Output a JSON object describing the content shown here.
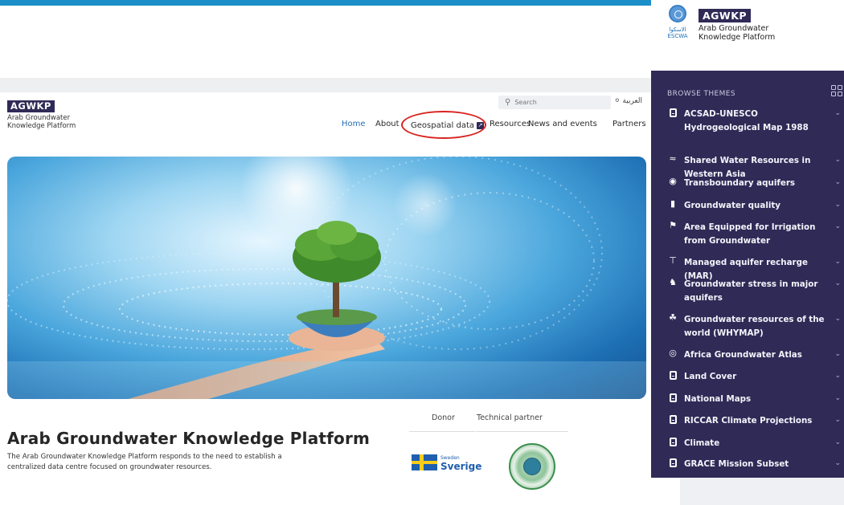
{
  "site": {
    "logo_title": "AGWKP",
    "logo_sub_line1": "Arab Groundwater",
    "logo_sub_line2": "Knowledge Platform",
    "search_placeholder": "Search",
    "language": "العربية"
  },
  "nav": {
    "home": "Home",
    "about": "About",
    "geospatial": "Geospatial data",
    "resources": "Resources",
    "news": "News and events",
    "partners": "Partners"
  },
  "main": {
    "title": "Arab Groundwater Knowledge Platform",
    "description": "The Arab Groundwater Knowledge Platform responds to the need to establish a centralized data centre focused on groundwater resources.",
    "donor_label": "Donor",
    "technical_partner_label": "Technical partner",
    "sweden_small": "Sweden",
    "sweden_big": "Sverige"
  },
  "panel": {
    "escwa_label_ar": "الاسكوا",
    "escwa_label": "ESCWA",
    "logo_title": "AGWKP",
    "logo_sub_line1": "Arab Groundwater",
    "logo_sub_line2": "Knowledge Platform",
    "browse_label": "BROWSE THEMES",
    "themes": [
      {
        "label": "ACSAD-UNESCO Hydrogeological Map 1988",
        "icon": "map-icon"
      },
      {
        "label": "Shared Water Resources in Western Asia",
        "icon": "waves-icon"
      },
      {
        "label": "Transboundary aquifers",
        "icon": "globe-icon"
      },
      {
        "label": "Groundwater quality",
        "icon": "water-glass-icon"
      },
      {
        "label": "Area Equipped for Irrigation from Groundwater",
        "icon": "irrigation-icon"
      },
      {
        "label": "Managed aquifer recharge (MAR)",
        "icon": "recharge-icon"
      },
      {
        "label": "Groundwater stress in major aquifers",
        "icon": "tap-icon"
      },
      {
        "label": "Groundwater resources of the world (WHYMAP)",
        "icon": "world-resources-icon"
      },
      {
        "label": "Africa Groundwater Atlas",
        "icon": "atlas-globe-icon"
      },
      {
        "label": "Land Cover",
        "icon": "map-icon"
      },
      {
        "label": "National Maps",
        "icon": "map-icon"
      },
      {
        "label": "RICCAR Climate Projections",
        "icon": "map-icon"
      },
      {
        "label": "Climate",
        "icon": "map-icon"
      },
      {
        "label": "GRACE Mission Subset",
        "icon": "map-icon"
      }
    ]
  },
  "colors": {
    "panel_bg": "#2f2a56",
    "top_bar": "#1d8fc8",
    "highlight": "#d9231f",
    "link_active": "#2a6fb6"
  }
}
